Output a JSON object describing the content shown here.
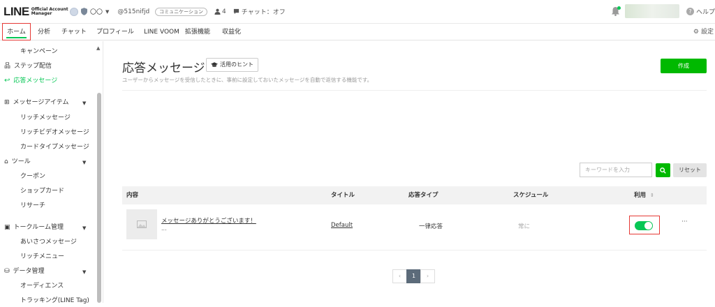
{
  "header": {
    "logo_main": "LINE",
    "logo_sub1": "Official Account",
    "logo_sub2": "Manager",
    "account_name": "〇〇",
    "account_id": "@515nifjd",
    "category_tag": "コミュニケーション",
    "member_count": "4",
    "chat_status": "チャット：オフ",
    "help_label": "ヘルプ"
  },
  "nav": {
    "items": [
      "ホーム",
      "分析",
      "チャット",
      "プロフィール",
      "LINE VOOM",
      "拡張機能",
      "収益化"
    ],
    "settings_label": "設定"
  },
  "sidebar": {
    "campaign": "キャンペーン",
    "step": "ステップ配信",
    "auto_reply": "応答メッセージ",
    "message_items": "メッセージアイテム",
    "rich_message": "リッチメッセージ",
    "rich_video": "リッチビデオメッセージ",
    "card_type": "カードタイプメッセージ",
    "tools": "ツール",
    "coupon": "クーポン",
    "shop_card": "ショップカード",
    "research": "リサーチ",
    "talk_room": "トークルーム管理",
    "greeting": "あいさつメッセージ",
    "rich_menu": "リッチメニュー",
    "data_mgmt": "データ管理",
    "audience": "オーディエンス",
    "tracking": "トラッキング(LINE Tag)"
  },
  "main": {
    "title": "応答メッセージ",
    "hint_label": "活用のヒント",
    "create_label": "作成",
    "description": "ユーザーからメッセージを受信したときに、事前に設定しておいたメッセージを自動で返信する機能です。",
    "search_placeholder": "キーワードを入力",
    "reset_label": "リセット"
  },
  "table": {
    "columns": [
      "内容",
      "タイトル",
      "応答タイプ",
      "スケジュール",
      "利用"
    ],
    "rows": [
      {
        "content": "メッセージありがとうございます！",
        "content_more": "...",
        "title": "Default",
        "reply_type": "一律応答",
        "schedule": "常に",
        "enabled": true,
        "actions": "···"
      }
    ]
  },
  "pagination": {
    "prev": "‹",
    "current": "1",
    "next": "›"
  },
  "colors": {
    "brand": "#06c755",
    "button": "#00b900",
    "highlight": "#e53935"
  }
}
